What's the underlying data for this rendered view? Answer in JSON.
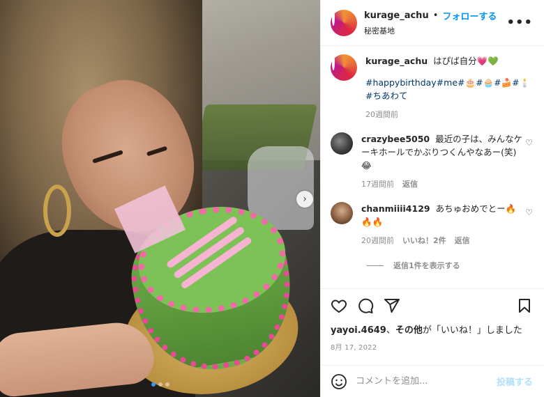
{
  "post": {
    "username": "kurage_achu",
    "separator": "•",
    "follow_label": "フォローする",
    "location": "秘密基地",
    "more_label": "•••"
  },
  "carousel": {
    "next_label": "›",
    "slide_count": 3,
    "active_slide": 1
  },
  "caption": {
    "username": "kurage_achu",
    "text": "はぴば自分💗💚",
    "hashtags": "#happybirthday#me#🎂#🧁#🍰#🕯️#ちあわて",
    "time": "20週間前"
  },
  "comments": [
    {
      "username": "crazybee5050",
      "text": "最近の子は、みんなケーキホールでかぶりつくんやなあー(笑)😂",
      "time": "17週間前",
      "likes": "",
      "reply_label": "返信",
      "heart": "♡"
    },
    {
      "username": "chanmiiii4129",
      "text": "あちゅおめでとー🔥🔥🔥",
      "time": "20週間前",
      "likes": "いいね！2件",
      "reply_label": "返信",
      "heart": "♡"
    }
  ],
  "view_replies": "返信1件を表示する",
  "likes": {
    "user": "yayoi.4649",
    "mid": "、",
    "others": "その他",
    "suffix": "が「いいね！」しました"
  },
  "date": "8月 17, 2022",
  "comment_box": {
    "placeholder": "コメントを追加...",
    "post_label": "投稿する"
  },
  "icons": {
    "like": "heart-icon",
    "comment": "comment-icon",
    "share": "share-icon",
    "save": "bookmark-icon",
    "emoji": "emoji-icon"
  },
  "colors": {
    "link_blue": "#0095f6",
    "hashtag": "#00376b",
    "muted": "#8e8e8e",
    "post_disabled": "#b2dffc"
  }
}
